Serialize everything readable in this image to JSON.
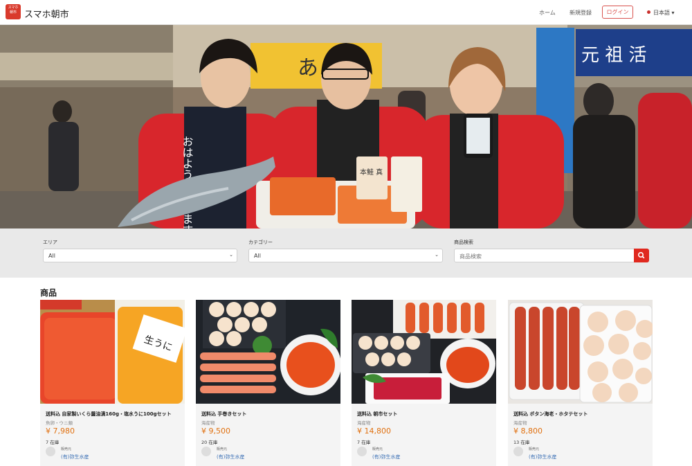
{
  "header": {
    "logo_text": "スマホ\n朝市",
    "brand": "スマホ朝市",
    "nav": {
      "home": "ホーム",
      "signup": "新規登録",
      "login": "ログイン",
      "language": "日本語"
    }
  },
  "hero": {
    "banner_left": "あ",
    "banner_right": "元 祖 活",
    "hand_sign": "おはようございます",
    "fish_pack": "本鮭 真"
  },
  "filters": {
    "area": {
      "label": "エリア",
      "value": "All"
    },
    "category": {
      "label": "カテゴリー",
      "value": "All"
    },
    "search": {
      "label": "商品検索",
      "placeholder": "商品検索"
    }
  },
  "products": {
    "section_title": "商品",
    "seller_label": "販売元",
    "items": [
      {
        "title": "送料込 自家製いくら醤油漬160g・塩水うに100gセット",
        "category": "魚卵・ウニ類",
        "price": "¥ 7,980",
        "stock": "7 在庫",
        "seller": "(有)弥生水産",
        "image_label": "生うに"
      },
      {
        "title": "送料込 手巻きセット",
        "category": "海産物",
        "price": "¥ 9,500",
        "stock": "20 在庫",
        "seller": "(有)弥生水産"
      },
      {
        "title": "送料込 朝市セット",
        "category": "海産物",
        "price": "¥ 14,800",
        "stock": "7 在庫",
        "seller": "(有)弥生水産"
      },
      {
        "title": "送料込 ボタン海老・ホタテセット",
        "category": "海産物",
        "price": "¥ 8,800",
        "stock": "13 在庫",
        "seller": "(有)弥生水産"
      }
    ]
  },
  "colors": {
    "accent": "#e0291f",
    "price": "#e0700f",
    "seller_link": "#3a6fb5",
    "filter_bg": "#e9e9e9"
  }
}
